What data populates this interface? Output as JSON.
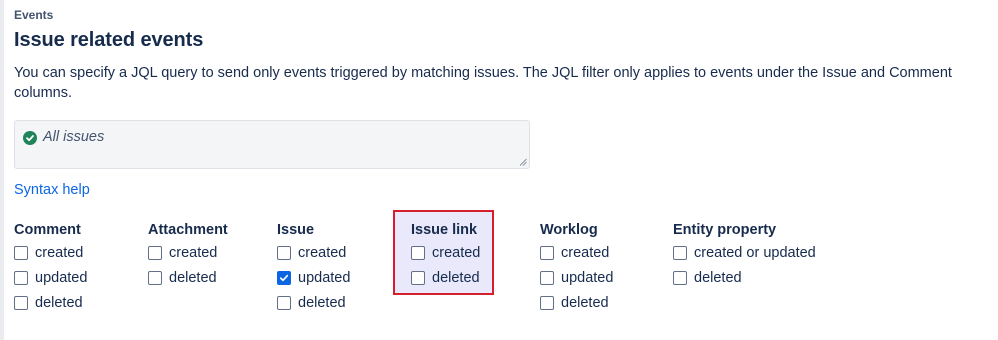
{
  "section_label": "Events",
  "title": "Issue related events",
  "description": "You can specify a JQL query to send only events triggered by matching issues. The JQL filter only applies to events under the Issue and Comment columns.",
  "jql": {
    "value": "All issues",
    "status_icon": "check-circle-icon",
    "status_color": "#1f845a"
  },
  "syntax_help": "Syntax help",
  "accent_color": "#0c66e4",
  "highlight_color": "#d61f2c",
  "columns": [
    {
      "heading": "Comment",
      "options": [
        {
          "label": "created",
          "checked": false
        },
        {
          "label": "updated",
          "checked": false
        },
        {
          "label": "deleted",
          "checked": false
        }
      ]
    },
    {
      "heading": "Attachment",
      "options": [
        {
          "label": "created",
          "checked": false
        },
        {
          "label": "deleted",
          "checked": false
        }
      ]
    },
    {
      "heading": "Issue",
      "options": [
        {
          "label": "created",
          "checked": false
        },
        {
          "label": "updated",
          "checked": true
        },
        {
          "label": "deleted",
          "checked": false
        }
      ]
    },
    {
      "heading": "Issue link",
      "highlighted": true,
      "options": [
        {
          "label": "created",
          "checked": false
        },
        {
          "label": "deleted",
          "checked": false
        }
      ]
    },
    {
      "heading": "Worklog",
      "options": [
        {
          "label": "created",
          "checked": false
        },
        {
          "label": "updated",
          "checked": false
        },
        {
          "label": "deleted",
          "checked": false
        }
      ]
    },
    {
      "heading": "Entity property",
      "options": [
        {
          "label": "created or updated",
          "checked": false
        },
        {
          "label": "deleted",
          "checked": false
        }
      ]
    }
  ]
}
